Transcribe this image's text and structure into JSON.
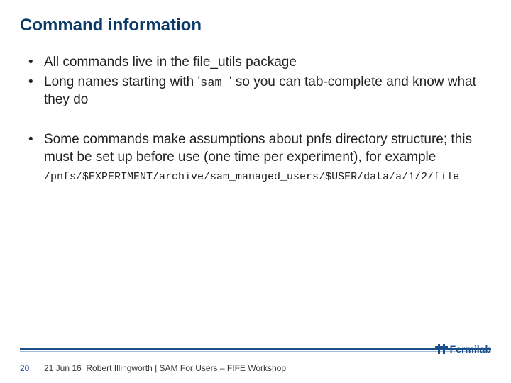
{
  "title": "Command information",
  "bullets": {
    "b1_pre": "All commands live in the file_utils package",
    "b2_pre": "Long names starting with '",
    "b2_code": "sam_",
    "b2_post": "' so you can tab-complete and know what they do",
    "b3": "Some commands make assumptions about pnfs directory structure; this must be set up before use (one time per experiment), for example"
  },
  "code_line": "/pnfs/$EXPERIMENT/archive/sam_managed_users/$USER/data/a/1/2/file",
  "footer": {
    "slide_number": "20",
    "date": "21 Jun 16",
    "attribution": "Robert Illingworth | SAM For Users – FIFE Workshop",
    "logo_text": "Fermilab"
  }
}
